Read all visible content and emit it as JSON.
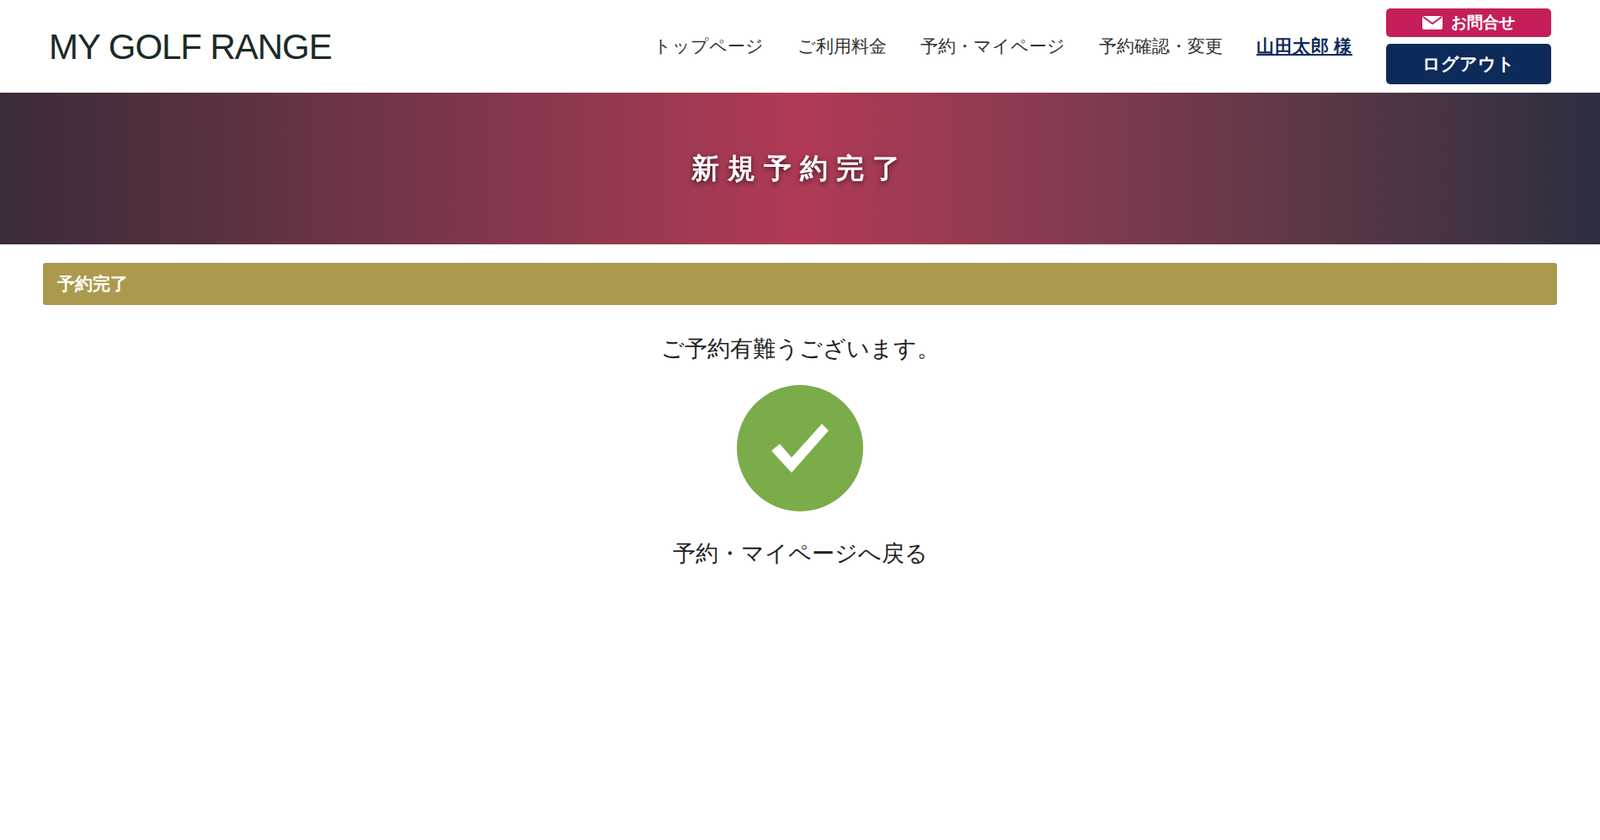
{
  "header": {
    "logo": "MY GOLF RANGE",
    "nav": [
      {
        "label": "トップページ"
      },
      {
        "label": "ご利用料金"
      },
      {
        "label": "予約・マイページ"
      },
      {
        "label": "予約確認・変更"
      }
    ],
    "user": "山田太郎 様",
    "contact_button": "お問合せ",
    "logout_button": "ログアウト"
  },
  "hero": {
    "title": "新規予約完了"
  },
  "section": {
    "title": "予約完了"
  },
  "message": "ご予約有難うございます。",
  "back_link": "予約・マイページへ戻る"
}
